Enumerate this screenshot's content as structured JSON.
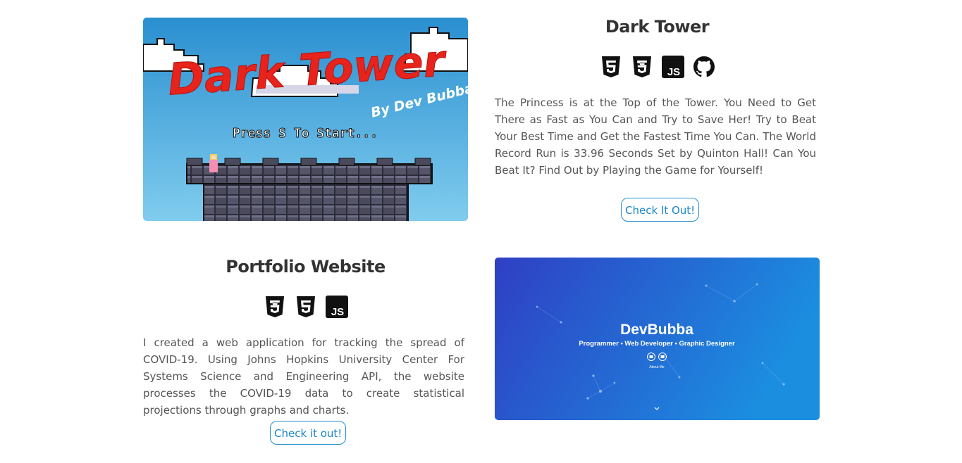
{
  "projects": [
    {
      "title": "Dark Tower",
      "description": "The Princess is at the Top of the Tower. You Need to Get There as Fast as You Can and Try to Save Her! Try to Beat Your Best Time and Get the Fastest Time You Can. The World Record Run is 33.96 Seconds Set by Quinton Hall! Can You Beat It? Find Out by Playing the Game for Yourself!",
      "button_label": "Check It Out!",
      "icons": [
        "html5-icon",
        "css3-icon",
        "javascript-icon",
        "github-icon"
      ],
      "thumbnail": {
        "logo_text": "Dark Tower",
        "byline": "By Dev Bubba",
        "prompt": "Press S To Start..."
      }
    },
    {
      "title": "Portfolio Website",
      "description": "I created a web application for tracking the spread of COVID-19. Using Johns Hopkins University Center For Systems Science and Engineering API, the website processes the COVID-19 data to create statistical projections through graphs and charts.",
      "button_label": "Check it out!",
      "icons": [
        "css3-icon",
        "html5-icon",
        "javascript-icon"
      ],
      "thumbnail": {
        "brand": "DevBubba",
        "tagline": "Programmer • Web Developer • Graphic Designer",
        "link": "About Me"
      }
    }
  ],
  "colors": {
    "accent": "#1f8fcf",
    "sky_top": "#2a8fd0",
    "sky_bottom": "#7fcbee",
    "logo_red": "#e8231c",
    "portfolio_left": "#2f3fc4",
    "portfolio_right": "#1b8ee0"
  }
}
